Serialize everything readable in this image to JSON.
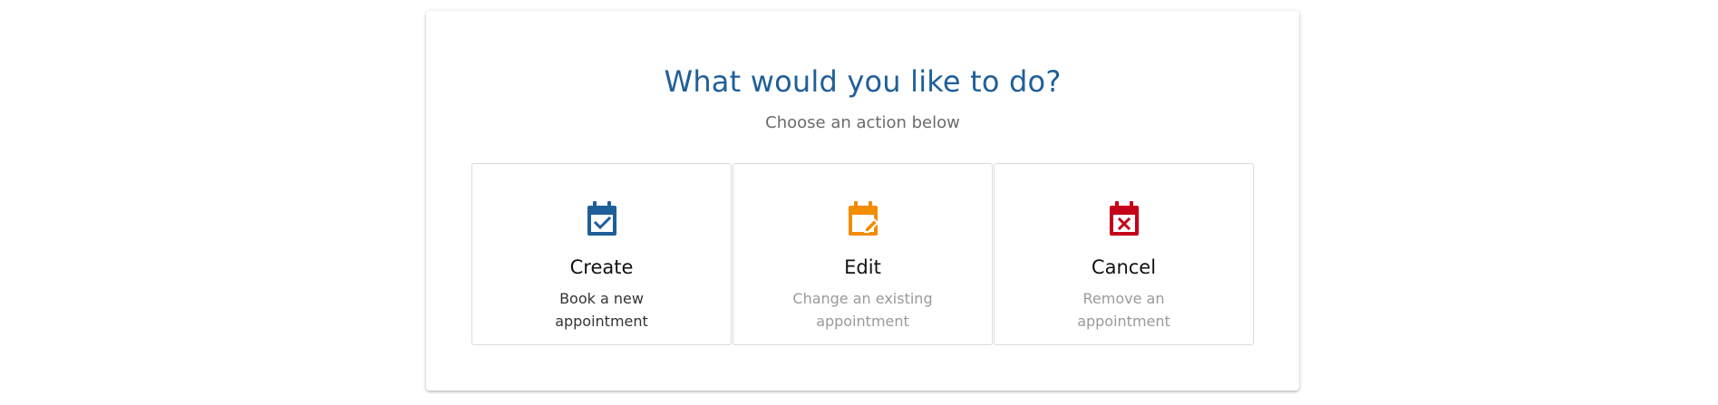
{
  "panel": {
    "title": "What would you like to do?",
    "subtitle": "Choose an action below"
  },
  "options": [
    {
      "label": "Create",
      "description": "Book a new appointment",
      "icon": "calendar-check-icon",
      "color": "#1f5f99"
    },
    {
      "label": "Edit",
      "description": "Change an existing appointment",
      "icon": "calendar-edit-icon",
      "color": "#f28c00"
    },
    {
      "label": "Cancel",
      "description": "Remove an appointment",
      "icon": "calendar-remove-icon",
      "color": "#c4001a"
    }
  ]
}
